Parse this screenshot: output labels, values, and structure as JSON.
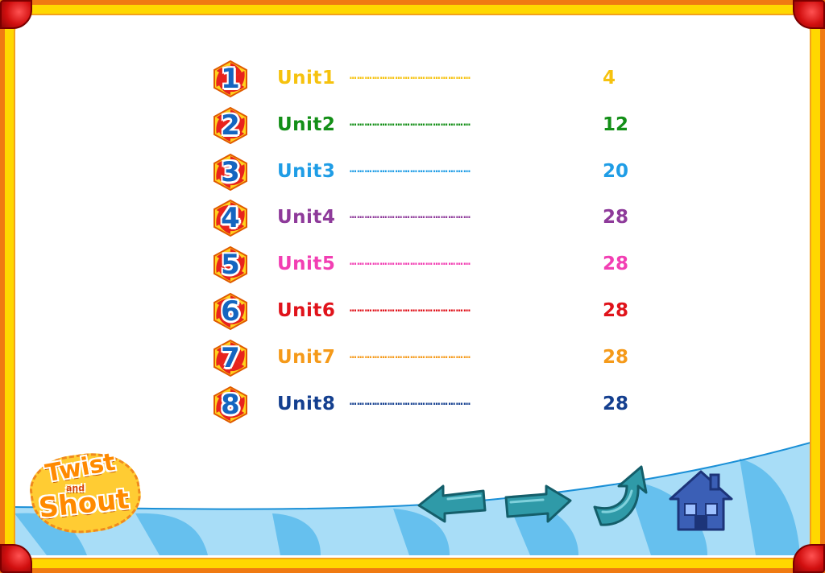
{
  "toc": {
    "rows": [
      {
        "number": "1",
        "label": "Unit1",
        "dots": "…………………………………………",
        "page": "4",
        "color": "#f6c20e"
      },
      {
        "number": "2",
        "label": "Unit2",
        "dots": "…………………………………………",
        "page": "12",
        "color": "#138f17"
      },
      {
        "number": "3",
        "label": "Unit3",
        "dots": "…………………………………………",
        "page": "20",
        "color": "#1f9de6"
      },
      {
        "number": "4",
        "label": "Unit4",
        "dots": "…………………………………………",
        "page": "28",
        "color": "#8e3a9a"
      },
      {
        "number": "5",
        "label": "Unit5",
        "dots": "…………………………………………",
        "page": "28",
        "color": "#f23fb3"
      },
      {
        "number": "6",
        "label": "Unit6",
        "dots": "…………………………………………",
        "page": "28",
        "color": "#e0131b"
      },
      {
        "number": "7",
        "label": "Unit7",
        "dots": "…………………………………………",
        "page": "28",
        "color": "#f59a1a"
      },
      {
        "number": "8",
        "label": "Unit8",
        "dots": "…………………………………………",
        "page": "28",
        "color": "#143f8f"
      }
    ]
  },
  "logo": {
    "line1": "Twist",
    "line2": "and",
    "line3": "Shout"
  },
  "nav": {
    "back_icon": "arrow-left-icon",
    "forward_icon": "arrow-right-icon",
    "return_icon": "curved-arrow-up-icon",
    "home_icon": "home-icon"
  },
  "colors": {
    "frame_yellow": "#ffd800",
    "frame_orange": "#f07a12",
    "corner_red": "#d10f0f",
    "wave_light": "#9ed9f7",
    "wave_mid": "#6cc3ef",
    "arrow_teal": "#2a8f9e",
    "home_blue": "#3b5fb6"
  }
}
